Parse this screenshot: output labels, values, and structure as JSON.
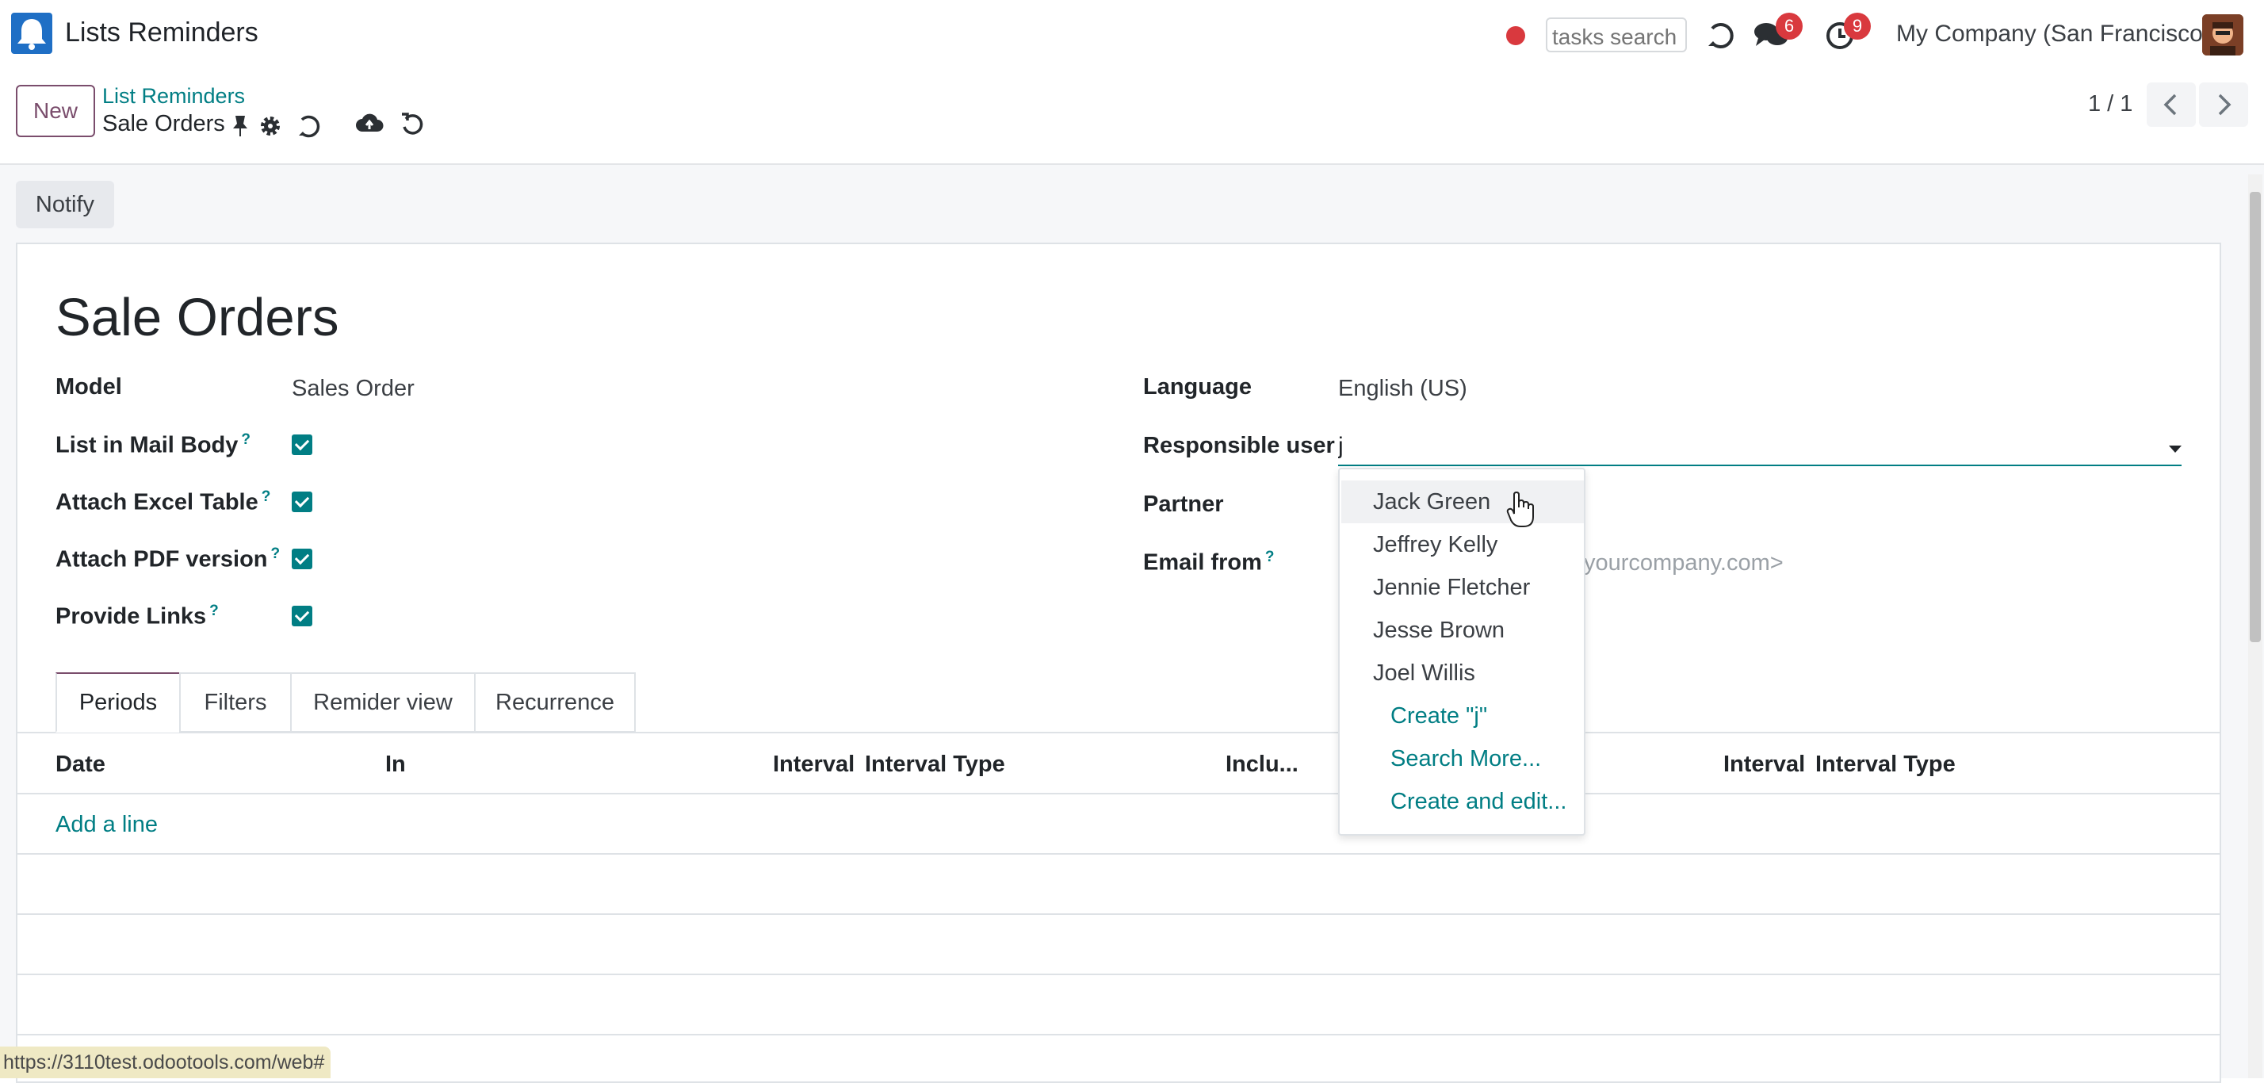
{
  "navbar": {
    "app_name": "Lists Reminders",
    "tasks_search_placeholder": "tasks search",
    "messages_badge": "6",
    "activities_badge": "9",
    "company": "My Company (San Francisco)"
  },
  "control_panel": {
    "new_label": "New",
    "breadcrumb_parent": "List Reminders",
    "breadcrumb_current": "Sale Orders",
    "pager": "1 / 1"
  },
  "actions": {
    "notify_label": "Notify"
  },
  "form": {
    "title": "Sale Orders",
    "left_fields": [
      {
        "label": "Model",
        "value": "Sales Order"
      },
      {
        "label": "List in Mail Body",
        "help": "?",
        "checked": true
      },
      {
        "label": "Attach Excel Table",
        "help": "?",
        "checked": true
      },
      {
        "label": "Attach PDF version",
        "help": "?",
        "checked": true
      },
      {
        "label": "Provide Links",
        "help": "?",
        "checked": true
      }
    ],
    "right_fields": [
      {
        "label": "Language",
        "value": "English (US)"
      },
      {
        "label": "Responsible user",
        "value": "j"
      },
      {
        "label": "Partner",
        "value": ""
      },
      {
        "label": "Email from",
        "help": "?",
        "value": "yourcompany.com>"
      }
    ]
  },
  "tabs": [
    {
      "label": "Periods",
      "active": true
    },
    {
      "label": "Filters",
      "active": false
    },
    {
      "label": "Remider view",
      "active": false
    },
    {
      "label": "Recurrence",
      "active": false
    }
  ],
  "table": {
    "headers": [
      "Date",
      "In",
      "Interval",
      "Interval Type",
      "Inclu...",
      "Interval",
      "Interval Type"
    ],
    "add_line_label": "Add a line"
  },
  "dropdown": {
    "options": [
      "Jack Green",
      "Jeffrey Kelly",
      "Jennie Fletcher",
      "Jesse Brown",
      "Joel Willis"
    ],
    "actions": [
      "Create \"j\"",
      "Search More...",
      "Create and edit..."
    ],
    "highlighted_index": 0
  },
  "status_bar": {
    "url": "https://3110test.odootools.com/web#"
  },
  "colors": {
    "accent": "#017e84",
    "brand": "#7a4d6c",
    "badge": "#d9393e"
  }
}
